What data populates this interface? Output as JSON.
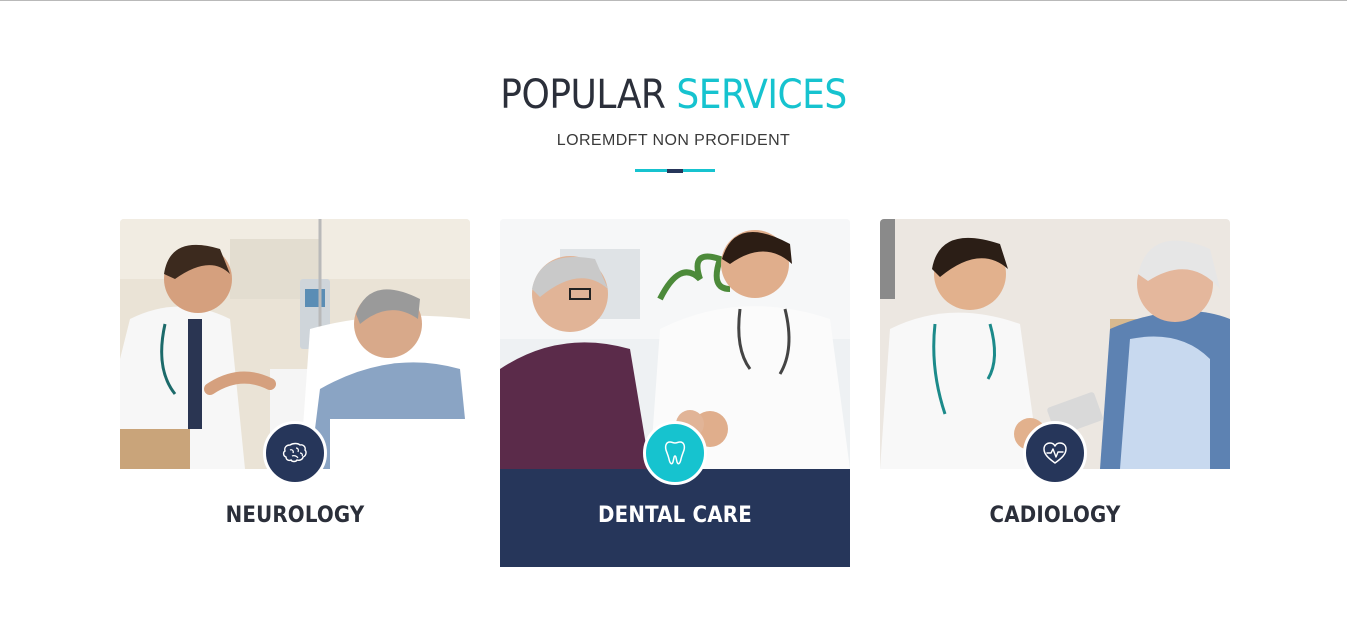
{
  "header": {
    "title_part1": "POPULAR ",
    "title_part2": "SERVICES",
    "subtitle": "LOREMDFT NON PROFIDENT"
  },
  "colors": {
    "accent": "#16c3cf",
    "navy": "#26365a",
    "text": "#2b2f3a"
  },
  "services": [
    {
      "label": "NEUROLOGY",
      "icon": "brain-icon",
      "active": false
    },
    {
      "label": "DENTAL CARE",
      "icon": "tooth-icon",
      "active": true
    },
    {
      "label": "CADIOLOGY",
      "icon": "heart-pulse-icon",
      "active": false
    }
  ]
}
